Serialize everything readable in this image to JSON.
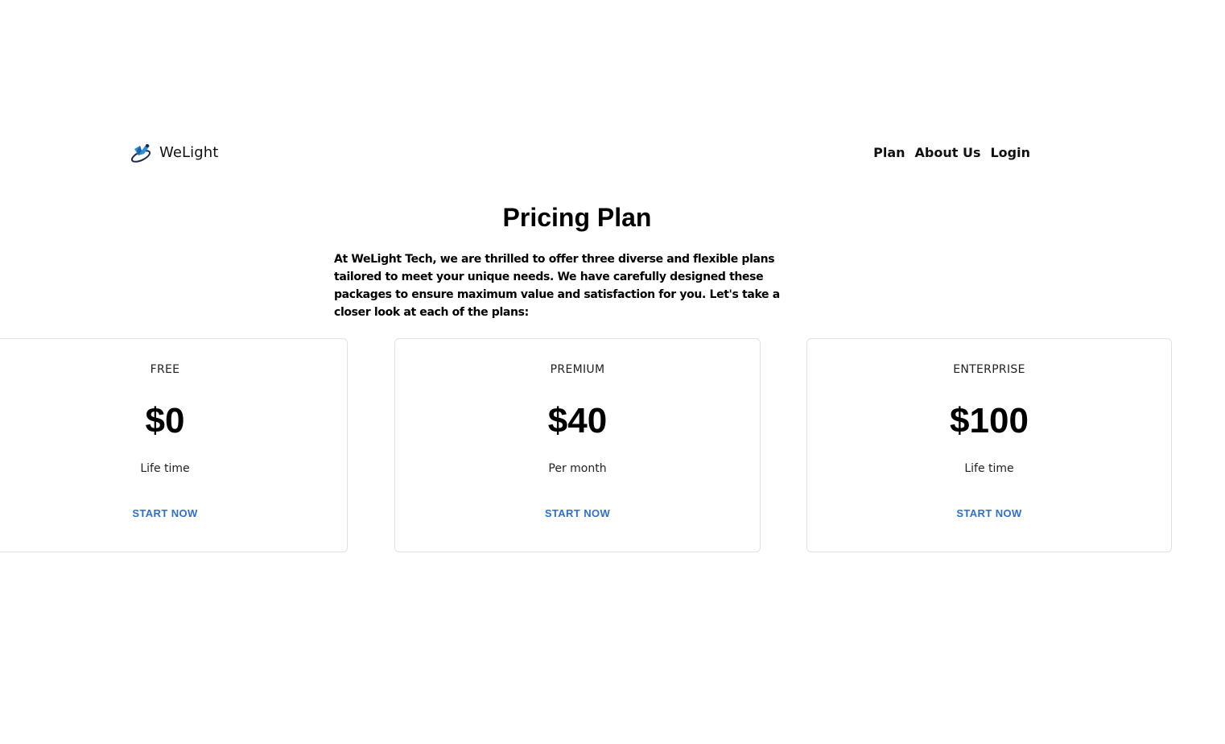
{
  "header": {
    "brand_name": "WeLight",
    "logo_icon": "bird-globe-logo-icon",
    "nav": [
      {
        "label": "Plan"
      },
      {
        "label": "About Us"
      },
      {
        "label": "Login"
      }
    ]
  },
  "main": {
    "title": "Pricing Plan",
    "intro": "At WeLight Tech, we are thrilled to offer three diverse and flexible plans tailored to meet your unique needs. We have carefully designed these packages to ensure maximum value and satisfaction for you. Let's take a closer look at each of the plans:",
    "plans": [
      {
        "name": "FREE",
        "price": "$0",
        "period": "Life time",
        "cta": "START NOW"
      },
      {
        "name": "PREMIUM",
        "price": "$40",
        "period": "Per month",
        "cta": "START NOW"
      },
      {
        "name": "ENTERPRISE",
        "price": "$100",
        "period": "Life time",
        "cta": "START NOW"
      }
    ]
  },
  "colors": {
    "accent": "#2f6fce",
    "card_border": "#e0e0e0",
    "text": "#000000"
  }
}
